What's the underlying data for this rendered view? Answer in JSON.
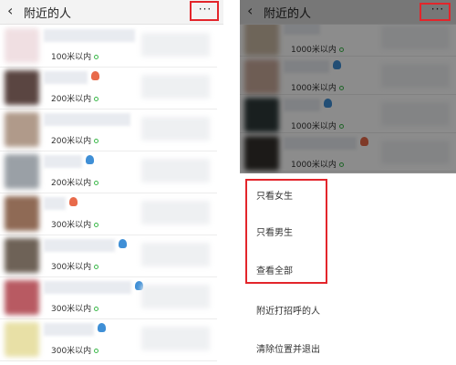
{
  "screens": {
    "left": {
      "title": "附近的人",
      "back_icon": "‹",
      "more_icon": "···",
      "people": [
        {
          "distance": "100米以内",
          "gender_icon": "none",
          "avatar_color": "#f0dfe2"
        },
        {
          "distance": "200米以内",
          "gender_icon": "female",
          "avatar_color": "#5a4541"
        },
        {
          "distance": "200米以内",
          "gender_icon": "none",
          "avatar_color": "#b09a8a"
        },
        {
          "distance": "200米以内",
          "gender_icon": "male",
          "avatar_color": "#9aa0a6"
        },
        {
          "distance": "300米以内",
          "gender_icon": "female",
          "avatar_color": "#8f6a55"
        },
        {
          "distance": "300米以内",
          "gender_icon": "male",
          "avatar_color": "#6e6257"
        },
        {
          "distance": "300米以内",
          "gender_icon": "male",
          "avatar_color": "#b85a62"
        },
        {
          "distance": "300米以内",
          "gender_icon": "male",
          "avatar_color": "#e8e0a6"
        }
      ]
    },
    "right": {
      "title": "附近的人",
      "back_icon": "‹",
      "more_icon": "···",
      "people": [
        {
          "distance": "1000米以内",
          "gender_icon": "none",
          "avatar_color": "#c9b8a3"
        },
        {
          "distance": "1000米以内",
          "gender_icon": "male",
          "avatar_color": "#c9a99a"
        },
        {
          "distance": "1000米以内",
          "gender_icon": "male",
          "avatar_color": "#2e3a3a"
        },
        {
          "distance": "1000米以内",
          "gender_icon": "female",
          "avatar_color": "#33302c"
        }
      ],
      "menu": {
        "girls_only": "只看女生",
        "boys_only": "只看男生",
        "show_all": "查看全部",
        "greeted": "附近打招呼的人",
        "clear_location": "清除位置并退出"
      }
    }
  },
  "colors": {
    "highlight": "#e3252b",
    "male": "#3f8fd6",
    "female": "#e86a4a",
    "online": "#3bb84a"
  }
}
